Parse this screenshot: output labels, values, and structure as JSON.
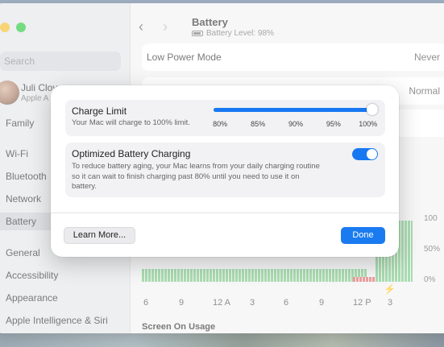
{
  "window": {
    "title": "Battery",
    "subtitle": "Battery Level: 98%"
  },
  "sidebar": {
    "search_placeholder": "Search",
    "profile": {
      "name": "Juli Clov",
      "sub": "Apple A"
    },
    "family": "Family",
    "items": [
      {
        "label": "Wi-Fi",
        "color": "#3a8ef0"
      },
      {
        "label": "Bluetooth",
        "color": "#3a8ef0"
      },
      {
        "label": "Network",
        "color": "#3a8ef0"
      },
      {
        "label": "Battery",
        "color": "#35c24d",
        "active": true
      },
      {
        "label": "General",
        "color": "#8e8e93"
      },
      {
        "label": "Accessibility",
        "color": "#2f7df6"
      },
      {
        "label": "Appearance",
        "color": "#222222"
      },
      {
        "label": "Apple Intelligence & Siri",
        "color": "#d957c8"
      }
    ]
  },
  "main": {
    "rows": [
      {
        "label": "Low Power Mode",
        "value": "Never"
      },
      {
        "label": "",
        "value": "Normal"
      },
      {
        "label": "",
        "value": ""
      }
    ],
    "chart_axis": [
      "6",
      "9",
      "12 A",
      "3",
      "6",
      "9",
      "12 P",
      "3"
    ],
    "pct_labels": [
      "100",
      "50%",
      "0%"
    ],
    "section_after_chart": "Screen On Usage"
  },
  "modal": {
    "charge_limit": {
      "title": "Charge Limit",
      "desc": "Your Mac will charge to 100% limit.",
      "ticks": [
        "80%",
        "85%",
        "90%",
        "95%",
        "100%"
      ],
      "value_percent": 100
    },
    "optimized": {
      "title": "Optimized Battery Charging",
      "desc_line1": "To reduce battery aging, your Mac learns from your daily charging routine",
      "desc_line2": "so it can wait to finish charging past 80% until you need to use it on",
      "desc_line3": "battery.",
      "enabled": true
    },
    "learn_more": "Learn More...",
    "done": "Done"
  },
  "colors": {
    "accent": "#1778f2",
    "chart_green": "#7dcb87",
    "chart_red": "#e36b6b"
  }
}
